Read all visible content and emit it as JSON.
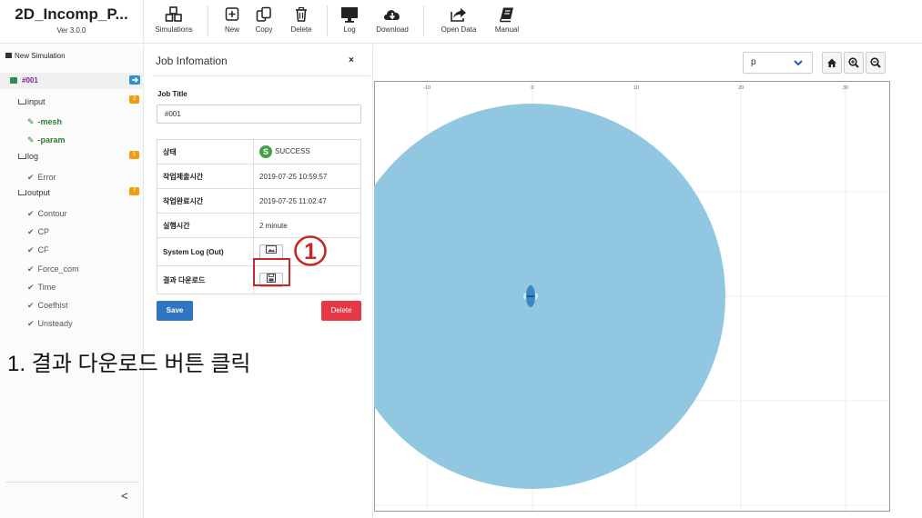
{
  "app": {
    "title": "2D_Incomp_P...",
    "version": "Ver 3.0.0"
  },
  "toolbar": [
    {
      "label": "Simulations",
      "icon": "cubes-icon"
    },
    {
      "label": "New",
      "icon": "plus-square-icon"
    },
    {
      "label": "Copy",
      "icon": "copy-icon"
    },
    {
      "label": "Delete",
      "icon": "trash-icon"
    },
    {
      "label": "Log",
      "icon": "monitor-icon"
    },
    {
      "label": "Download",
      "icon": "cloud-download-icon"
    },
    {
      "label": "Open Data",
      "icon": "share-icon"
    },
    {
      "label": "Manual",
      "icon": "book-icon"
    }
  ],
  "sidebar": {
    "new_simulation": "New Simulation",
    "sim_id": "#001",
    "input": {
      "label": "input",
      "badge": "2",
      "children": [
        "-mesh",
        "-param"
      ]
    },
    "log": {
      "label": "log",
      "badge": "1",
      "children": [
        "Error"
      ]
    },
    "output": {
      "label": "output",
      "badge": "7",
      "children": [
        "Contour",
        "CP",
        "CF",
        "Force_com",
        "Time",
        "Coefhist",
        "Unsteady"
      ]
    },
    "collapse": "<"
  },
  "panel": {
    "title": "Job Infomation",
    "close": "×",
    "job_title_label": "Job Title",
    "job_title_value": "#001",
    "rows": {
      "status_label": "상태",
      "status_badge": "S",
      "status_value": "SUCCESS",
      "submit_label": "작업제출시간",
      "submit_value": "2019-07-25 10:59:57",
      "complete_label": "작업완료시간",
      "complete_value": "2019-07-25 11:02:47",
      "runtime_label": "실행시간",
      "runtime_value": "2 minute",
      "syslog_label": "System Log (Out)",
      "download_label": "결과 다운로드"
    },
    "save": "Save",
    "delete": "Delete"
  },
  "marker": "1",
  "annotation": "1. 결과 다운로드 버튼 클릭",
  "viewer": {
    "variable": "p",
    "x_ticks": [
      "-10",
      "0",
      "10",
      "20",
      "30"
    ],
    "colors": {
      "domain": "#91c7e1",
      "accent": "#2f76c1",
      "danger": "#e53945",
      "success": "#43a047"
    }
  }
}
